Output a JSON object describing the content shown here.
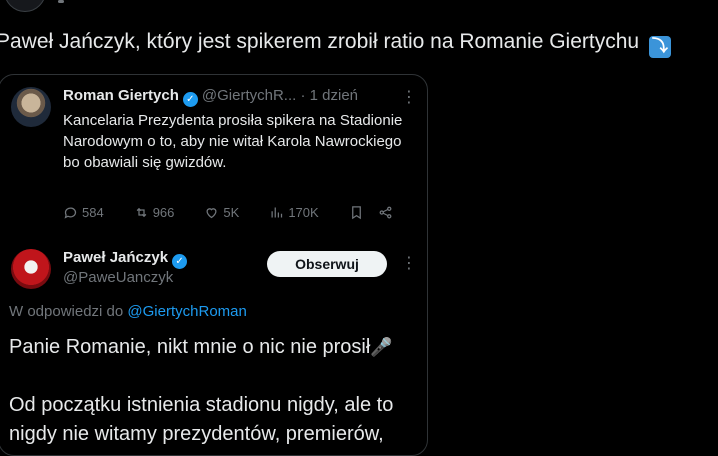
{
  "post": {
    "text": "Paweł Jańczyk, który jest spikerem zrobił ratio na Romanie Giertychu",
    "emoji_icon": "arrow-down-right-emoji",
    "emoji_glyph": "⤵"
  },
  "quoted": {
    "name": "Roman Giertych",
    "handle": "@GiertychR...",
    "time": "· 1 dzień",
    "text": "Kancelaria Prezydenta prosiła spikera na Stadionie Narodowym o to, aby nie witał Karola Nawrockiego bo obawiali się gwizdów.",
    "actions": {
      "replies": "584",
      "reposts": "966",
      "likes": "5K",
      "views": "170K"
    }
  },
  "reply": {
    "name": "Paweł Jańczyk",
    "handle": "@PaweUanczyk",
    "follow_label": "Obserwuj",
    "reply_prefix": "W odpowiedzi do",
    "reply_to": "@GiertychRoman",
    "line1": "Panie Romanie, nikt mnie o nic nie prosił",
    "mic_icon": "microphone-emoji",
    "mic_glyph": "🎤",
    "line2": "Od początku istnienia stadionu nigdy, ale to",
    "line3": "nigdy nie witamy prezydentów, premierów,"
  },
  "colors": {
    "background": "#000000",
    "text": "#e7e9ea",
    "muted": "#71767b",
    "accent": "#1d9bf0",
    "border": "#2f3336"
  }
}
